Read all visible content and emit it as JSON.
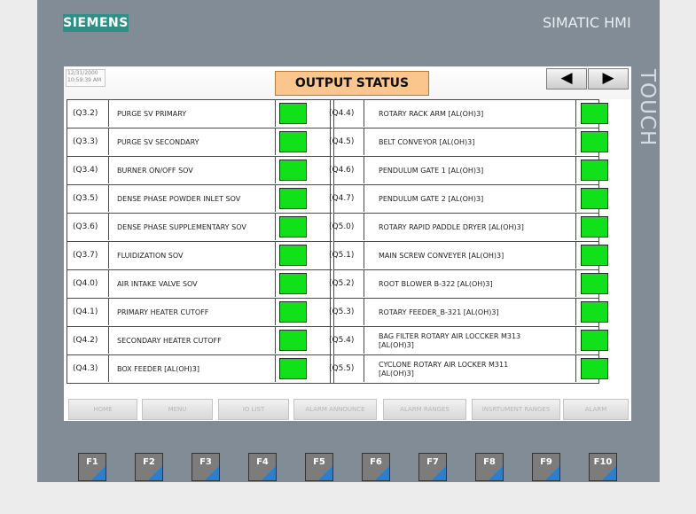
{
  "brand": "SIEMENS",
  "model": "SIMATIC HMI",
  "panel_label": "TOUCH",
  "datetime": {
    "date": "12/31/2000",
    "time": "10:59:39 AM"
  },
  "title": "OUTPUT STATUS",
  "nav": {
    "prev_icon": "◀",
    "next_icon": "▶"
  },
  "left_rows": [
    {
      "addr": "(Q3.2)",
      "name": "PURGE SV PRIMARY"
    },
    {
      "addr": "(Q3.3)",
      "name": "PURGE SV SECONDARY"
    },
    {
      "addr": "(Q3.4)",
      "name": "BURNER ON/OFF SOV"
    },
    {
      "addr": "(Q3.5)",
      "name": "DENSE PHASE POWDER INLET SOV"
    },
    {
      "addr": "(Q3.6)",
      "name": "DENSE PHASE SUPPLEMENTARY SOV"
    },
    {
      "addr": "(Q3.7)",
      "name": "FLUIDIZATION SOV"
    },
    {
      "addr": "(Q4.0)",
      "name": "AIR INTAKE VALVE SOV"
    },
    {
      "addr": "(Q4.1)",
      "name": "PRIMARY HEATER CUTOFF"
    },
    {
      "addr": "(Q4.2)",
      "name": "SECONDARY HEATER CUTOFF"
    },
    {
      "addr": "(Q4.3)",
      "name": "BOX FEEDER [AL(OH)3]"
    }
  ],
  "right_rows": [
    {
      "addr": "(Q4.4)",
      "name": "ROTARY RACK ARM [AL(OH)3]"
    },
    {
      "addr": "(Q4.5)",
      "name": "BELT CONVEYOR [AL(OH)3]"
    },
    {
      "addr": "(Q4.6)",
      "name": "PENDULUM GATE 1 [AL(OH)3]"
    },
    {
      "addr": "(Q4.7)",
      "name": "PENDULUM GATE 2 [AL(OH)3]"
    },
    {
      "addr": "(Q5.0)",
      "name": "ROTARY RAPID PADDLE DRYER [AL(OH)3]"
    },
    {
      "addr": "(Q5.1)",
      "name": "MAIN SCREW CONVEYER [AL(OH)3]"
    },
    {
      "addr": "(Q5.2)",
      "name": "ROOT BLOWER B-322 [AL(OH)3]"
    },
    {
      "addr": "(Q5.3)",
      "name": "ROTARY FEEDER_B-321 [AL(OH)3]"
    },
    {
      "addr": "(Q5.4)",
      "name": "BAG FILTER ROTARY AIR LOCCKER M313 [AL(OH)3]"
    },
    {
      "addr": "(Q5.5)",
      "name": "CYCLONE ROTARY AIR LOCKER M311 [AL(OH)3]"
    }
  ],
  "status_color": "#11e11a",
  "function_buttons": [
    "HOME",
    "MENU",
    "IO LIST",
    "ALARM ANNOUNCE",
    "ALARM RANGES",
    "INSRTUMENT RANGES",
    "ALARM"
  ],
  "hardware_keys": [
    "F1",
    "F2",
    "F3",
    "F4",
    "F5",
    "F6",
    "F7",
    "F8",
    "F9",
    "F10"
  ]
}
